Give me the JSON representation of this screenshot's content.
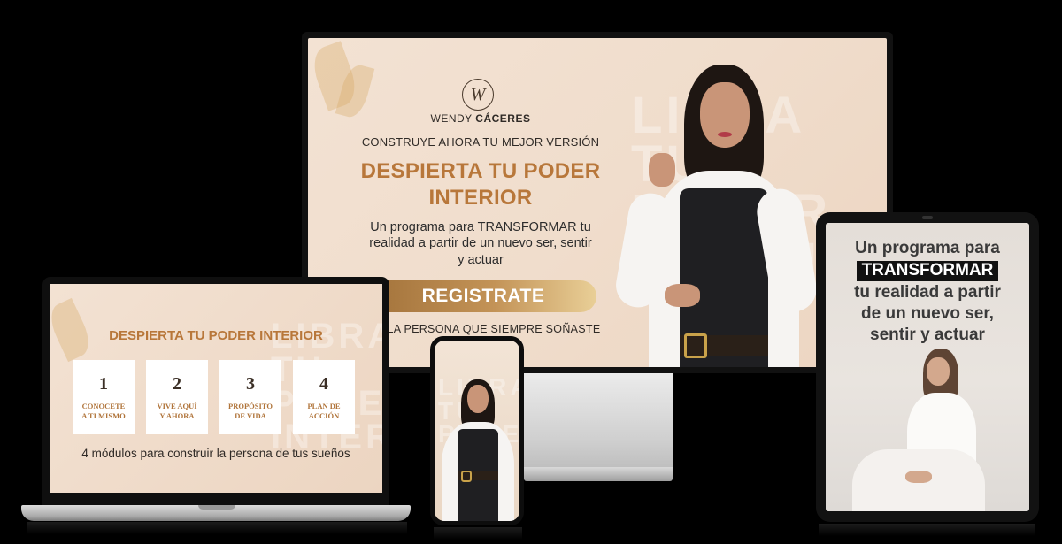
{
  "monitor": {
    "brand_logo_letter": "W",
    "brand_first": "WENDY",
    "brand_last": "CÁCERES",
    "kicker": "CONSTRUYE AHORA TU MEJOR VERSIÓN",
    "title_line1": "DESPIERTA TU PODER",
    "title_line2": "INTERIOR",
    "subtitle_line1": "Un programa para TRANSFORMAR tu",
    "subtitle_line2": "realidad a partir de un nuevo ser, sentir",
    "subtitle_line3": "y actuar",
    "cta_label": "REGISTRATE",
    "footer": "LA PERSONA QUE SIEMPRE SOÑASTE"
  },
  "laptop": {
    "title": "DESPIERTA TU PODER INTERIOR",
    "modules": [
      {
        "number": "1",
        "line1": "CONOCETE",
        "line2": "A TI MISMO"
      },
      {
        "number": "2",
        "line1": "VIVE AQUÍ",
        "line2": "Y AHORA"
      },
      {
        "number": "3",
        "line1": "PROPÓSITO",
        "line2": "DE VIDA"
      },
      {
        "number": "4",
        "line1": "PLAN DE",
        "line2": "ACCIÓN"
      }
    ],
    "description": "4 módulos para construir la persona de tus sueños"
  },
  "tablet": {
    "line1": "Un programa para",
    "highlight": "TRANSFORMAR",
    "line3": "tu realidad a partir",
    "line4": "de un nuevo ser,",
    "line5": "sentir y actuar"
  },
  "colors": {
    "accent_gold": "#b8773a",
    "background_peach": "#f3e2d3",
    "cta_gradient_start": "#a3733b",
    "cta_gradient_end": "#e9cf97"
  }
}
